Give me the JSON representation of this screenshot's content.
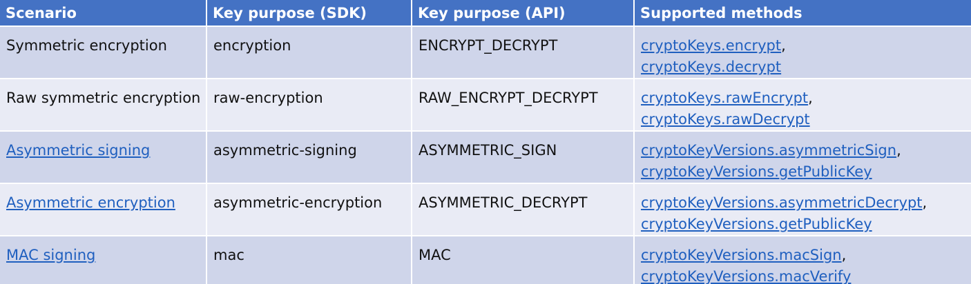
{
  "table": {
    "headers": [
      "Scenario",
      "Key purpose (SDK)",
      "Key purpose (API)",
      "Supported methods"
    ],
    "rows": [
      {
        "scenario": "Symmetric encryption",
        "scenario_is_link": false,
        "sdk_purpose": "encryption",
        "api_purpose": "ENCRYPT_DECRYPT",
        "methods": [
          "cryptoKeys.encrypt",
          "cryptoKeys.decrypt"
        ]
      },
      {
        "scenario": "Raw symmetric encryption",
        "scenario_is_link": false,
        "sdk_purpose": "raw-encryption",
        "api_purpose": "RAW_ENCRYPT_DECRYPT",
        "methods": [
          "cryptoKeys.rawEncrypt",
          "cryptoKeys.rawDecrypt"
        ]
      },
      {
        "scenario": "Asymmetric signing",
        "scenario_is_link": true,
        "sdk_purpose": "asymmetric-signing",
        "api_purpose": "ASYMMETRIC_SIGN",
        "methods": [
          "cryptoKeyVersions.asymmetricSign",
          "cryptoKeyVersions.getPublicKey"
        ]
      },
      {
        "scenario": "Asymmetric encryption",
        "scenario_is_link": true,
        "sdk_purpose": "asymmetric-encryption",
        "api_purpose": "ASYMMETRIC_DECRYPT",
        "methods": [
          "cryptoKeyVersions.asymmetricDecrypt",
          "cryptoKeyVersions.getPublicKey"
        ]
      },
      {
        "scenario": "MAC signing",
        "scenario_is_link": true,
        "sdk_purpose": "mac",
        "api_purpose": "MAC",
        "methods": [
          "cryptoKeyVersions.macSign",
          "cryptoKeyVersions.macVerify"
        ]
      }
    ],
    "colors": {
      "header_bg": "#4472c4",
      "row_dark": "#cfd5ea",
      "row_light": "#e9ebf5",
      "link": "#1f5fbf"
    }
  }
}
